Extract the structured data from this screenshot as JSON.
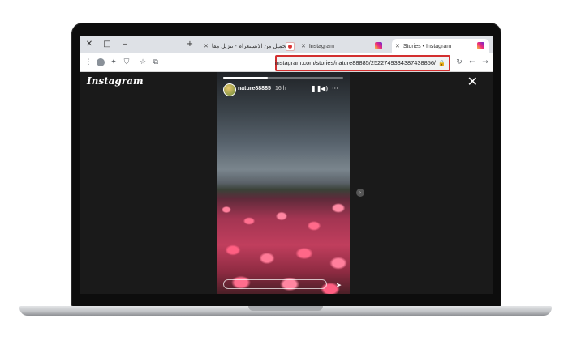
{
  "browser": {
    "tabs": [
      {
        "label": "التحميل من الانستغرام - تنزيل مقا",
        "favicon": "red-heart-icon",
        "active": false
      },
      {
        "label": "Instagram",
        "favicon": "instagram-icon",
        "active": false
      },
      {
        "label": "Stories • Instagram",
        "favicon": "instagram-icon",
        "active": true
      }
    ],
    "new_tab_symbol": "+",
    "address_url": "instagram.com/stories/nature88885/2522749334387438856/",
    "accent_color": "#d32f2f"
  },
  "page": {
    "logo_text": "Instagram",
    "story": {
      "username": "nature88885",
      "time": "16 h",
      "progress_fraction": 0.37
    }
  }
}
